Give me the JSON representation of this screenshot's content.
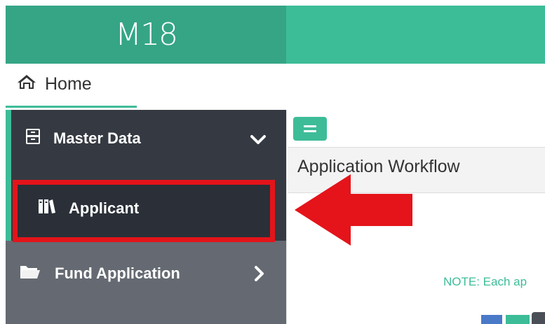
{
  "brand": {
    "logo_text": "M18",
    "header_color": "#3dbc98",
    "logo_bg_color": "#35a586"
  },
  "breadcrumb": {
    "home_icon": "home-icon",
    "home_label": "Home"
  },
  "sidebar": {
    "items": [
      {
        "label": "Master Data",
        "icon": "archive-icon",
        "expanded": true
      },
      {
        "label": "Applicant",
        "icon": "binders-icon",
        "highlighted": true,
        "highlight_color": "#e4141a"
      },
      {
        "label": "Fund Application",
        "icon": "folder-icon",
        "expanded": false
      }
    ]
  },
  "main": {
    "toggle_icon": "menu-toggle-icon",
    "panel_title": "Application Workflow",
    "note_text": "NOTE: Each ap"
  },
  "annotation": {
    "arrow_color": "#e4141a"
  }
}
